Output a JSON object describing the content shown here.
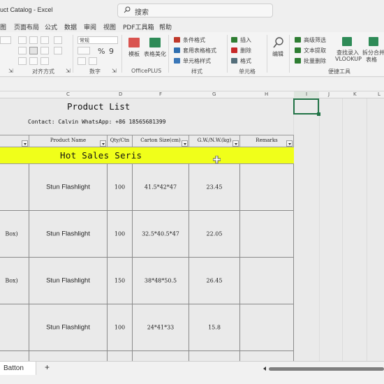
{
  "window": {
    "doc_title": "uct Catalog  -  Excel",
    "search_placeholder": "搜索"
  },
  "menu": [
    "图",
    "页面布局",
    "公式",
    "数据",
    "审阅",
    "视图",
    "PDF工具箱",
    "帮助"
  ],
  "ribbon": {
    "number_format": "常规",
    "percent": "%",
    "comma": "9",
    "groups": {
      "alignment": "对齐方式",
      "number": "数字",
      "officeplus": "OfficePLUS",
      "styles": "样式",
      "cells": "单元格",
      "tools": "便捷工具"
    },
    "buttons": {
      "template": "模板",
      "beautify": "表格美化",
      "conditional": "条件格式",
      "table_format": "套用表格格式",
      "cell_style": "单元格样式",
      "insert": "插入",
      "delete": "删除",
      "format": "格式",
      "edit": "编辑",
      "adv_filter": "高级筛选",
      "text_extract": "文本提取",
      "batch_delete": "批量删除",
      "vlookup_a": "查找录入",
      "vlookup_b": "VLOOKUP",
      "split_a": "拆分合并",
      "split_b": "表格"
    }
  },
  "columns": [
    "C",
    "D",
    "F",
    "G",
    "H",
    "I",
    "J",
    "K",
    "L"
  ],
  "sheet": {
    "title": "Product List",
    "contact": "Contact: Calvin   WhatsApp: +86 18565681399",
    "headers": [
      "Product Name",
      "Qty/Ctn",
      "Carton Size(cm)",
      "G.W./N.W.(kg)",
      "Remarks"
    ],
    "banner": "Hot Sales Seris",
    "rows": [
      {
        "a": "",
        "name": "Stun Flashlight",
        "qty": "100",
        "size": "41.5*42*47",
        "gw": "23.45"
      },
      {
        "a": "Box)",
        "name": "Stun Flashlight",
        "qty": "100",
        "size": "32.5*40.5*47",
        "gw": "22.05"
      },
      {
        "a": "Box)",
        "name": "Stun Flashlight",
        "qty": "150",
        "size": "38*48*50.5",
        "gw": "26.45"
      },
      {
        "a": "",
        "name": "Stun Flashlight",
        "qty": "100",
        "size": "24*41*33",
        "gw": "15.8"
      }
    ]
  },
  "tabs": {
    "sheet": "Batton",
    "add": "+"
  }
}
